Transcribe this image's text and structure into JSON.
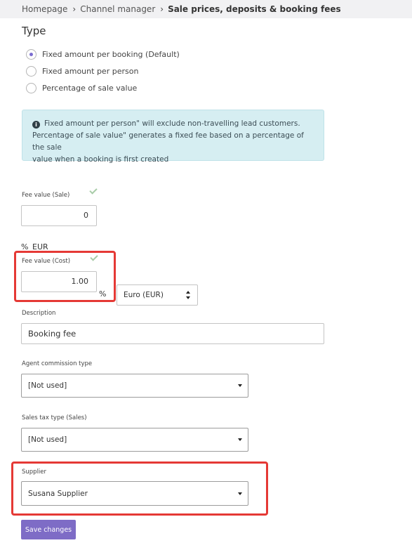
{
  "breadcrumb": {
    "items": [
      "Homepage",
      "Channel manager"
    ],
    "current": "Sale prices, deposits & booking fees"
  },
  "type_section": {
    "title": "Type",
    "options": [
      {
        "label": "Fixed amount per booking (Default)",
        "selected": true
      },
      {
        "label": "Fixed amount per person",
        "selected": false
      },
      {
        "label": "Percentage of sale value",
        "selected": false
      }
    ]
  },
  "info": {
    "line1": "Fixed amount per person\" will exclude non-travelling lead customers.",
    "line2": "Percentage of sale value\" generates a fixed fee based on a percentage of the sale",
    "line3": "value when a booking is first created"
  },
  "fee_sale": {
    "label": "Fee value (Sale)",
    "value": "0"
  },
  "unit_options": {
    "percent": "%",
    "currency": "EUR"
  },
  "fee_cost": {
    "label": "Fee value (Cost)",
    "value": "1.00",
    "unit": "%"
  },
  "currency_select": {
    "value": "Euro (EUR)"
  },
  "description": {
    "label": "Description",
    "value": "Booking fee"
  },
  "agent_commission": {
    "label": "Agent commission type",
    "value": "[Not used]"
  },
  "sales_tax": {
    "label": "Sales tax type (Sales)",
    "value": "[Not used]"
  },
  "supplier": {
    "label": "Supplier",
    "value": "Susana Supplier"
  },
  "actions": {
    "save_label": "Save changes"
  },
  "icons": {
    "info": "info-icon",
    "check": "check-icon",
    "caret": "chevron-down-icon"
  },
  "colors": {
    "accent": "#7e6cc6",
    "info_bg": "#d6eef2",
    "highlight": "#e53935",
    "check": "#a8cca8"
  }
}
